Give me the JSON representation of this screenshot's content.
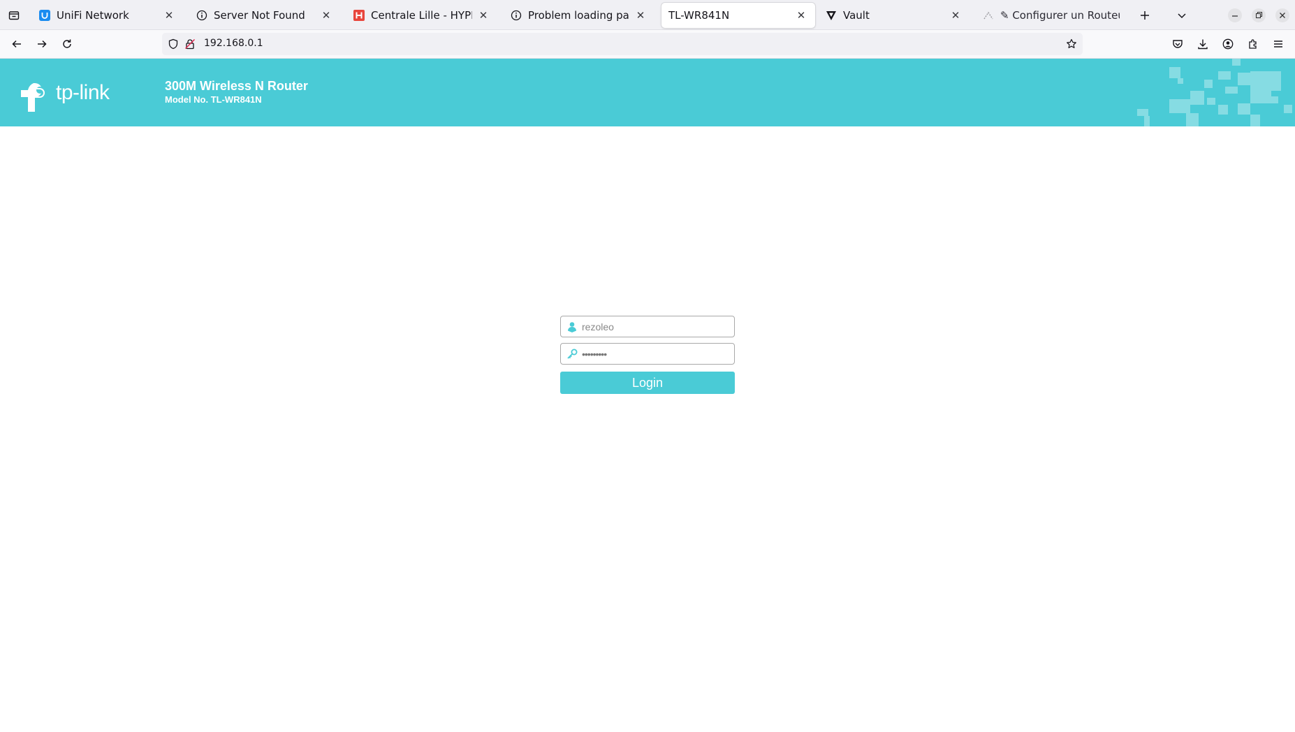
{
  "browser": {
    "tabs": [
      {
        "title": "UniFi Network",
        "icon": "unifi-icon",
        "active": false
      },
      {
        "title": "Server Not Found",
        "icon": "info-icon",
        "active": false
      },
      {
        "title": "Centrale Lille - HYPERPLANNING",
        "icon": "hyperplanning-icon",
        "active": false
      },
      {
        "title": "Problem loading page",
        "icon": "info-icon",
        "active": false
      },
      {
        "title": "TL-WR841N",
        "icon": "none",
        "active": true
      },
      {
        "title": "Vault",
        "icon": "vault-icon",
        "active": false
      },
      {
        "title": "✎ Configurer un Routeur",
        "icon": "placeholder-icon",
        "active": false
      }
    ],
    "url": "192.168.0.1"
  },
  "router": {
    "brand": "tp-link",
    "product_title": "300M Wireless N Router",
    "model_number": "Model No. TL-WR841N",
    "accent_color": "#4acbd6"
  },
  "login": {
    "username_value": "rezoleo",
    "password_value": "•••••••••",
    "button_label": "Login"
  }
}
